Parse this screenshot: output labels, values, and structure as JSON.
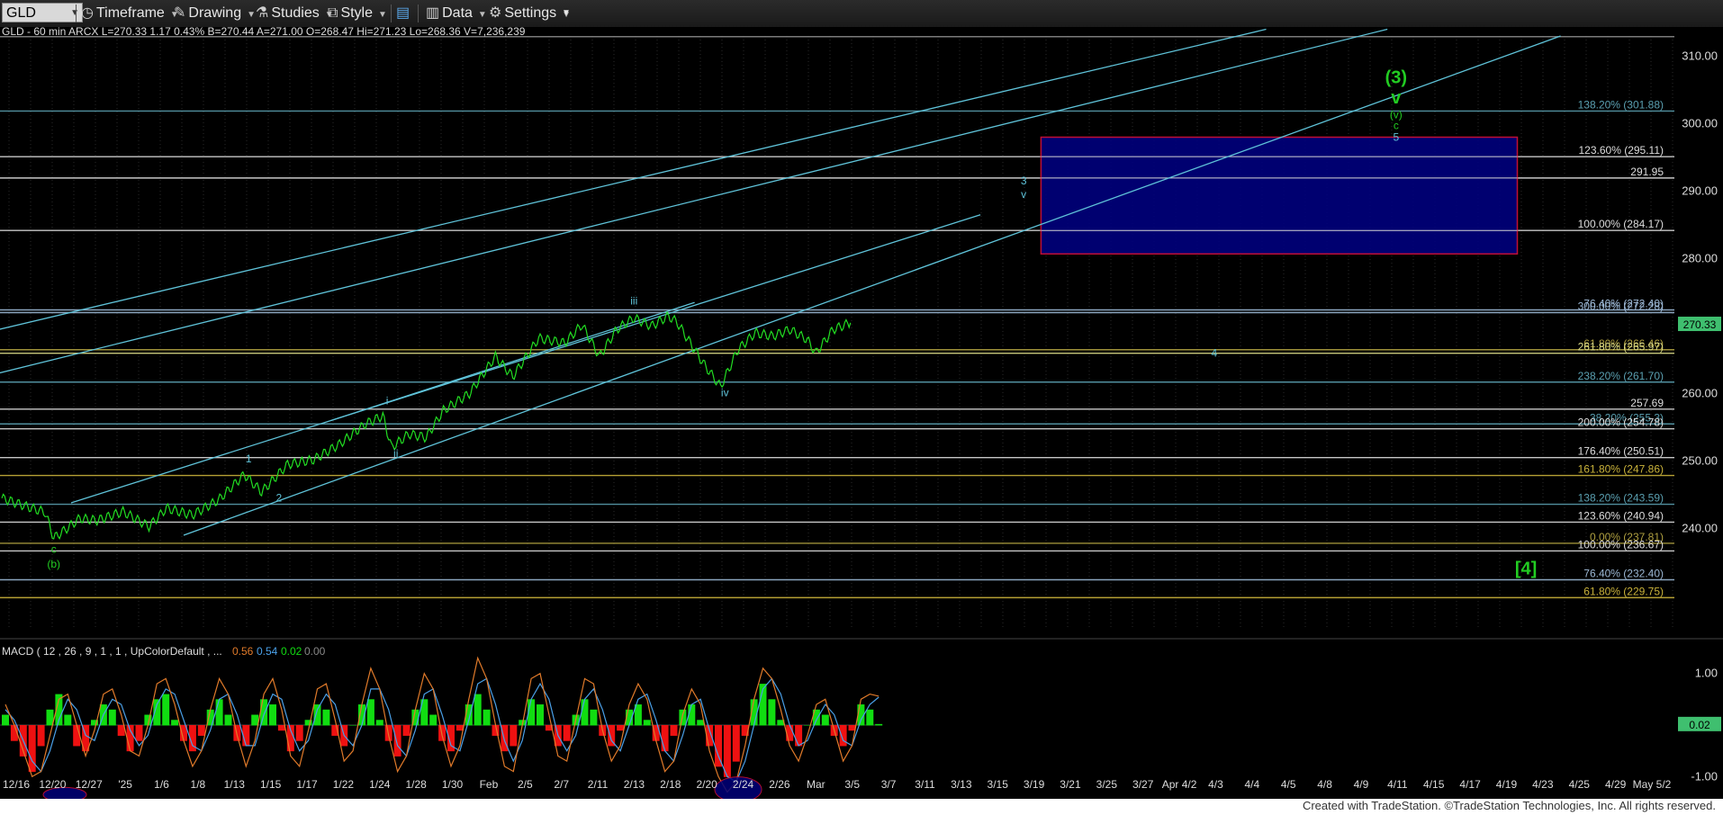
{
  "toolbar": {
    "symbol": "GLD",
    "timeframe": "Timeframe",
    "drawing": "Drawing",
    "studies": "Studies",
    "style": "Style",
    "data": "Data",
    "settings": "Settings"
  },
  "header": {
    "info": "GLD - 60 min  ARCX  L=270.33  1.17  0.43%  B=270.44  A=271.00  O=268.47  Hi=271.23  Lo=268.36  V=7,236,239"
  },
  "macd_header": {
    "label": "MACD ( 12 , 26 , 9 , 1 , 1 , UpColorDefault , ...",
    "v1": "0.56",
    "v2": "0.54",
    "v3": "0.02",
    "v4": "0.00"
  },
  "footer": "Created with TradeStation. ©TradeStation Technologies, Inc. All rights reserved.",
  "colors": {
    "price_line": "#22dd22",
    "channel_line": "#5fc3d9",
    "target_box_fill": "#00007a",
    "target_box_border": "#d0103a",
    "green_label": "#22cc22",
    "cyan_label": "#5fc3d9",
    "macd_line": "#e07a2a",
    "signal_line": "#4aa0e8",
    "hist_up": "#11dd11",
    "hist_down": "#ee1111",
    "last_price_badge": "#3fbf6f"
  },
  "chart_data": {
    "type": "line",
    "symbol": "GLD",
    "interval": "60 min",
    "ylim": [
      225,
      313
    ],
    "y_ticks": [
      240,
      250,
      260,
      270,
      280,
      290,
      300,
      310
    ],
    "x_tick_labels": [
      "12/16",
      "12/20",
      "12/27",
      "'25",
      "1/6",
      "1/8",
      "1/13",
      "1/15",
      "1/17",
      "1/22",
      "1/24",
      "1/28",
      "1/30",
      "Feb",
      "2/5",
      "2/7",
      "2/11",
      "2/13",
      "2/18",
      "2/20",
      "2/24",
      "2/26",
      "Mar",
      "3/5",
      "3/7",
      "3/11",
      "3/13",
      "3/15",
      "3/19",
      "3/21",
      "3/25",
      "3/27",
      "Apr 4/2",
      "4/3",
      "4/4",
      "4/5",
      "4/8",
      "4/9",
      "4/11",
      "4/15",
      "4/17",
      "4/19",
      "4/23",
      "4/25",
      "4/29",
      "May 5/2"
    ],
    "last_price": "270.33",
    "price_series": [
      {
        "t": 0,
        "v": 244.5
      },
      {
        "t": 3,
        "v": 243.2
      },
      {
        "t": 5,
        "v": 242.4
      },
      {
        "t": 6,
        "v": 238.6
      },
      {
        "t": 7,
        "v": 239.5
      },
      {
        "t": 9,
        "v": 241.5
      },
      {
        "t": 11,
        "v": 241.2
      },
      {
        "t": 14,
        "v": 242.5
      },
      {
        "t": 17,
        "v": 240.3
      },
      {
        "t": 19,
        "v": 243.0
      },
      {
        "t": 22,
        "v": 242.0
      },
      {
        "t": 25,
        "v": 244.2
      },
      {
        "t": 28,
        "v": 248.0
      },
      {
        "t": 30,
        "v": 245.4
      },
      {
        "t": 33,
        "v": 249.5
      },
      {
        "t": 36,
        "v": 250.2
      },
      {
        "t": 39,
        "v": 252.5
      },
      {
        "t": 42,
        "v": 255.5
      },
      {
        "t": 44,
        "v": 256.7
      },
      {
        "t": 45,
        "v": 252.0
      },
      {
        "t": 47,
        "v": 254.0
      },
      {
        "t": 49,
        "v": 253.5
      },
      {
        "t": 51,
        "v": 257.5
      },
      {
        "t": 54,
        "v": 260.0
      },
      {
        "t": 57,
        "v": 265.5
      },
      {
        "t": 59,
        "v": 262.5
      },
      {
        "t": 62,
        "v": 268.2
      },
      {
        "t": 65,
        "v": 267.5
      },
      {
        "t": 67,
        "v": 270.2
      },
      {
        "t": 69,
        "v": 265.5
      },
      {
        "t": 71,
        "v": 269.5
      },
      {
        "t": 73,
        "v": 271.2
      },
      {
        "t": 75,
        "v": 270.0
      },
      {
        "t": 77,
        "v": 271.5
      },
      {
        "t": 78,
        "v": 270.5
      },
      {
        "t": 79,
        "v": 268.5
      },
      {
        "t": 81,
        "v": 264.5
      },
      {
        "t": 83,
        "v": 261.0
      },
      {
        "t": 85,
        "v": 266.5
      },
      {
        "t": 87,
        "v": 269.0
      },
      {
        "t": 89,
        "v": 268.5
      },
      {
        "t": 91,
        "v": 269.5
      },
      {
        "t": 93,
        "v": 268.0
      },
      {
        "t": 94,
        "v": 266.0
      },
      {
        "t": 96,
        "v": 269.5
      },
      {
        "t": 98,
        "v": 270.5
      }
    ],
    "horizontal_levels": [
      {
        "pct": "",
        "value": 312.9,
        "color": "#888888",
        "label": ""
      },
      {
        "pct": "138.20%",
        "value": 301.88,
        "color": "#5a9fb0",
        "label": "138.20% (301.88)"
      },
      {
        "pct": "123.60%",
        "value": 295.11,
        "color": "#dddddd",
        "label": "123.60% (295.11)"
      },
      {
        "pct": "",
        "value": 291.95,
        "color": "#dddddd",
        "label": "291.95"
      },
      {
        "pct": "100.00%",
        "value": 284.17,
        "color": "#dddddd",
        "label": "100.00% (284.17)"
      },
      {
        "pct": "",
        "value": 272.4,
        "color": "#9bb7d4",
        "label": "76.40% (272.40)"
      },
      {
        "pct": "",
        "value": 272.0,
        "color": "#9bb7d4",
        "label": "300.00% (272.28)"
      },
      {
        "pct": "",
        "value": 266.5,
        "color": "#b0a040",
        "label": "61.80% (266.46)"
      },
      {
        "pct": "261.80%",
        "value": 265.97,
        "color": "#dddd88",
        "label": "261.80% (265.97)"
      },
      {
        "pct": "238.20%",
        "value": 261.7,
        "color": "#5a9fb0",
        "label": "238.20% (261.70)"
      },
      {
        "pct": "",
        "value": 257.69,
        "color": "#dddddd",
        "label": "257.69"
      },
      {
        "pct": "",
        "value": 255.5,
        "color": "#5a9fb0",
        "label": "38.20% (255.3)"
      },
      {
        "pct": "200.00%",
        "value": 254.78,
        "color": "#dddddd",
        "label": "200.00% (254.78)"
      },
      {
        "pct": "176.40%",
        "value": 250.51,
        "color": "#dddddd",
        "label": "176.40% (250.51)"
      },
      {
        "pct": "161.80%",
        "value": 247.86,
        "color": "#c9b23a",
        "label": "161.80% (247.86)"
      },
      {
        "pct": "138.20%",
        "value": 243.59,
        "color": "#5a9fb0",
        "label": "138.20% (243.59)"
      },
      {
        "pct": "123.60%",
        "value": 240.94,
        "color": "#dddddd",
        "label": "123.60% (240.94)"
      },
      {
        "pct": "0.00%",
        "value": 237.81,
        "color": "#b0a040",
        "label": "0.00% (237.81)"
      },
      {
        "pct": "100.00%",
        "value": 236.67,
        "color": "#dddddd",
        "label": "100.00% (236.67)"
      },
      {
        "pct": "76.40%",
        "value": 232.4,
        "color": "#9bb7d4",
        "label": "76.40% (232.40)"
      },
      {
        "pct": "61.80%",
        "value": 229.75,
        "color": "#c9b23a",
        "label": "61.80% (229.75)"
      }
    ],
    "target_box": {
      "from_value": 280.7,
      "to_value": 298.0,
      "t_start": 120,
      "t_end": 175
    },
    "wave_labels": [
      {
        "text": "c",
        "t": 6,
        "v": 236.4,
        "color": "green"
      },
      {
        "text": "(b)",
        "t": 6,
        "v": 234.2,
        "color": "green"
      },
      {
        "text": "1",
        "t": 28.5,
        "v": 249.8,
        "color": "cyan"
      },
      {
        "text": "2",
        "t": 32,
        "v": 244.0,
        "color": "cyan"
      },
      {
        "text": "i",
        "t": 44.5,
        "v": 258.4,
        "color": "cyan"
      },
      {
        "text": "ii",
        "t": 45.5,
        "v": 250.6,
        "color": "cyan"
      },
      {
        "text": "iii",
        "t": 73,
        "v": 273.2,
        "color": "cyan"
      },
      {
        "text": "iv",
        "t": 83.5,
        "v": 259.6,
        "color": "cyan"
      },
      {
        "text": "3",
        "t": 118,
        "v": 291.0,
        "color": "cyan"
      },
      {
        "text": "v",
        "t": 118,
        "v": 289.0,
        "color": "cyan"
      },
      {
        "text": "4",
        "t": 140,
        "v": 265.5,
        "color": "cyan"
      },
      {
        "text": "(3)",
        "t": 161,
        "v": 306.0,
        "color": "green"
      },
      {
        "text": "v",
        "t": 161,
        "v": 303.0,
        "color": "green"
      },
      {
        "text": "(v)",
        "t": 161,
        "v": 300.8,
        "color": "green"
      },
      {
        "text": "c",
        "t": 161,
        "v": 299.2,
        "color": "green"
      },
      {
        "text": "5",
        "t": 161,
        "v": 297.5,
        "color": "cyan"
      },
      {
        "text": "[4]",
        "t": 176,
        "v": 233.2,
        "color": "green"
      }
    ],
    "channel_lines": [
      {
        "t1": -2,
        "v1": 269.0,
        "t2": 146,
        "v2": 314.0
      },
      {
        "t1": -2,
        "v1": 262.5,
        "t2": 160,
        "v2": 314.0
      },
      {
        "t1": 8,
        "v1": 243.8,
        "t2": 113,
        "v2": 286.5
      },
      {
        "t1": 21,
        "v1": 239.0,
        "t2": 180,
        "v2": 313.0
      },
      {
        "t1": 38,
        "v1": 256.0,
        "t2": 80,
        "v2": 273.5
      }
    ],
    "macd": {
      "ylim": [
        -1.5,
        1.5
      ],
      "y_ticks": [
        1.0,
        0.0,
        -1.0
      ],
      "last_hist": "0.02",
      "hist": [
        0.2,
        -0.3,
        -0.6,
        -0.9,
        -0.4,
        0.3,
        0.6,
        0.2,
        -0.4,
        -0.5,
        0.1,
        0.4,
        0.3,
        -0.2,
        -0.5,
        -0.3,
        0.2,
        0.5,
        0.6,
        0.1,
        -0.3,
        -0.5,
        -0.2,
        0.3,
        0.5,
        0.2,
        -0.3,
        -0.4,
        0.2,
        0.5,
        0.4,
        -0.1,
        -0.5,
        -0.3,
        0.1,
        0.4,
        0.3,
        -0.2,
        -0.4,
        0.0,
        0.4,
        0.5,
        0.1,
        -0.3,
        -0.6,
        -0.2,
        0.3,
        0.5,
        0.2,
        -0.3,
        -0.5,
        -0.1,
        0.4,
        0.6,
        0.3,
        -0.2,
        -0.5,
        -0.4,
        0.1,
        0.5,
        0.4,
        -0.1,
        -0.4,
        -0.3,
        0.2,
        0.5,
        0.3,
        -0.2,
        -0.4,
        -0.1,
        0.3,
        0.4,
        0.1,
        -0.3,
        -0.5,
        -0.2,
        0.3,
        0.4,
        0.1,
        -0.4,
        -0.8,
        -1.0,
        -0.7,
        -0.2,
        0.5,
        0.8,
        0.5,
        0.1,
        -0.3,
        -0.4,
        0.0,
        0.3,
        0.2,
        -0.2,
        -0.4,
        -0.1,
        0.4,
        0.3,
        0.02
      ],
      "macd_line": [
        0.4,
        0.0,
        -0.5,
        -1.0,
        -0.9,
        -0.2,
        0.5,
        0.6,
        0.0,
        -0.6,
        -0.1,
        0.6,
        0.7,
        0.2,
        -0.5,
        -0.6,
        0.0,
        0.8,
        0.9,
        0.4,
        -0.3,
        -0.8,
        -0.5,
        0.3,
        0.9,
        0.6,
        -0.2,
        -0.8,
        -0.3,
        0.6,
        0.9,
        0.3,
        -0.6,
        -0.8,
        -0.1,
        0.7,
        0.8,
        0.1,
        -0.7,
        -0.5,
        0.4,
        1.1,
        0.7,
        -0.2,
        -0.9,
        -0.6,
        0.3,
        1.0,
        0.7,
        -0.2,
        -0.8,
        -0.4,
        0.5,
        1.3,
        0.9,
        0.0,
        -0.8,
        -0.9,
        0.0,
        0.9,
        1.0,
        0.2,
        -0.6,
        -0.7,
        0.1,
        0.9,
        0.8,
        -0.1,
        -0.7,
        -0.4,
        0.4,
        0.8,
        0.5,
        -0.3,
        -0.9,
        -0.7,
        0.2,
        0.7,
        0.4,
        -0.5,
        -1.0,
        -1.3,
        -1.1,
        -0.4,
        0.5,
        1.1,
        0.9,
        0.3,
        -0.4,
        -0.7,
        -0.2,
        0.4,
        0.5,
        -0.1,
        -0.7,
        -0.4,
        0.5,
        0.6,
        0.56
      ],
      "signal_line": [
        0.3,
        0.1,
        -0.3,
        -0.7,
        -0.9,
        -0.5,
        0.1,
        0.5,
        0.3,
        -0.2,
        -0.3,
        0.2,
        0.5,
        0.4,
        -0.1,
        -0.4,
        -0.2,
        0.4,
        0.7,
        0.6,
        0.1,
        -0.4,
        -0.5,
        -0.1,
        0.5,
        0.6,
        0.2,
        -0.4,
        -0.4,
        0.2,
        0.6,
        0.5,
        -0.1,
        -0.5,
        -0.3,
        0.3,
        0.6,
        0.4,
        -0.2,
        -0.4,
        0.0,
        0.7,
        0.7,
        0.3,
        -0.4,
        -0.6,
        -0.1,
        0.6,
        0.7,
        0.2,
        -0.4,
        -0.5,
        0.1,
        0.8,
        0.9,
        0.4,
        -0.3,
        -0.7,
        -0.3,
        0.5,
        0.8,
        0.5,
        -0.2,
        -0.5,
        -0.2,
        0.5,
        0.7,
        0.3,
        -0.3,
        -0.5,
        0.0,
        0.5,
        0.6,
        0.1,
        -0.5,
        -0.7,
        -0.2,
        0.4,
        0.5,
        -0.1,
        -0.6,
        -1.0,
        -1.1,
        -0.7,
        0.0,
        0.7,
        0.9,
        0.6,
        0.0,
        -0.4,
        -0.3,
        0.1,
        0.4,
        0.2,
        -0.3,
        -0.4,
        0.1,
        0.4,
        0.54
      ]
    }
  }
}
